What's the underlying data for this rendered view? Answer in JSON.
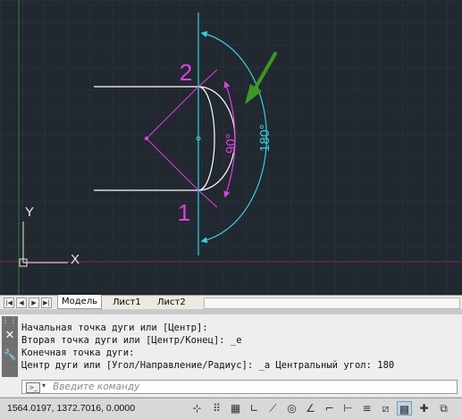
{
  "drawing": {
    "label_point_1": "1",
    "label_point_2": "2",
    "label_angle_90": "90°",
    "label_angle_180": "180°",
    "ucs_y": "Y",
    "ucs_x": "X",
    "colors": {
      "background": "#212830",
      "magenta": "#e040e0",
      "cyan": "#2ed3e0",
      "white": "#ffffff",
      "green_arrow": "#3a9a1e",
      "ucs": "#e6e6e6"
    }
  },
  "layout_tabs": {
    "items": [
      {
        "label": "Модель",
        "active": true
      },
      {
        "label": "Лист1",
        "active": false
      },
      {
        "label": "Лист2",
        "active": false
      }
    ]
  },
  "command_line": {
    "history": [
      "Начальная точка дуги или [Центр]:",
      "Вторая точка дуги или [Центр/Конец]: _e",
      "Конечная точка дуги:",
      "Центр дуги или [Угол/Направление/Радиус]: _a Центральный угол: 180"
    ],
    "placeholder": "Введите команду"
  },
  "status_bar": {
    "coordinates": "1564.0197, 1372.7016, 0.0000"
  }
}
